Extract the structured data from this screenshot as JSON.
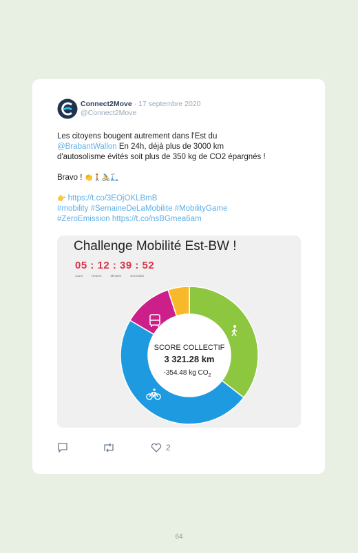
{
  "tweet": {
    "author_name": "Connect2Move",
    "separator": "·",
    "date": "17 septembre 2020",
    "handle": "@Connect2Move",
    "line1": "Les citoyens bougent autrement dans l'Est du",
    "mention": "@BrabantWallon",
    "line2_rest": " En 24h, déjà plus de 3000 km",
    "line3": "d'autosolisme évités soit plus de 350 kg de CO2 épargnés !",
    "bravo": "Bravo ! ",
    "bravo_emojis": "👏🚶🚴🛴",
    "pointer_emoji": "👉",
    "link1": "https://t.co/3EOjOKLBmB",
    "hashtags1": "#mobility #SemaineDeLaMobilite #MobilityGame",
    "hashtag_zero": "#ZeroEmission",
    "link2": "https://t.co/nsBGmea6am"
  },
  "challenge": {
    "title": "Challenge Mobilité Est-BW !",
    "timer": "05 : 12 : 39 : 52",
    "timer_labels": [
      "Jours",
      "Heures",
      "Minutes",
      "Secondes"
    ],
    "score_label": "SCORE COLLECTIF",
    "score_km": "3 321.28 km",
    "score_co2": "-354.48 kg CO",
    "score_co2_sub": "2",
    "segments": [
      {
        "name": "walking",
        "share": 0.355,
        "color": "#8dc63f",
        "icon": "walking-icon"
      },
      {
        "name": "cycling",
        "share": 0.48,
        "color": "#1e9be0",
        "icon": "bicycle-icon"
      },
      {
        "name": "bus",
        "share": 0.115,
        "color": "#cc1f8a",
        "icon": "bus-icon"
      },
      {
        "name": "other",
        "share": 0.05,
        "color": "#f7b829",
        "icon": ""
      }
    ]
  },
  "actions": {
    "reply_icon": "reply-icon",
    "retweet_icon": "retweet-icon",
    "like_icon": "heart-icon",
    "like_count": "2"
  },
  "page": {
    "number": "64"
  }
}
